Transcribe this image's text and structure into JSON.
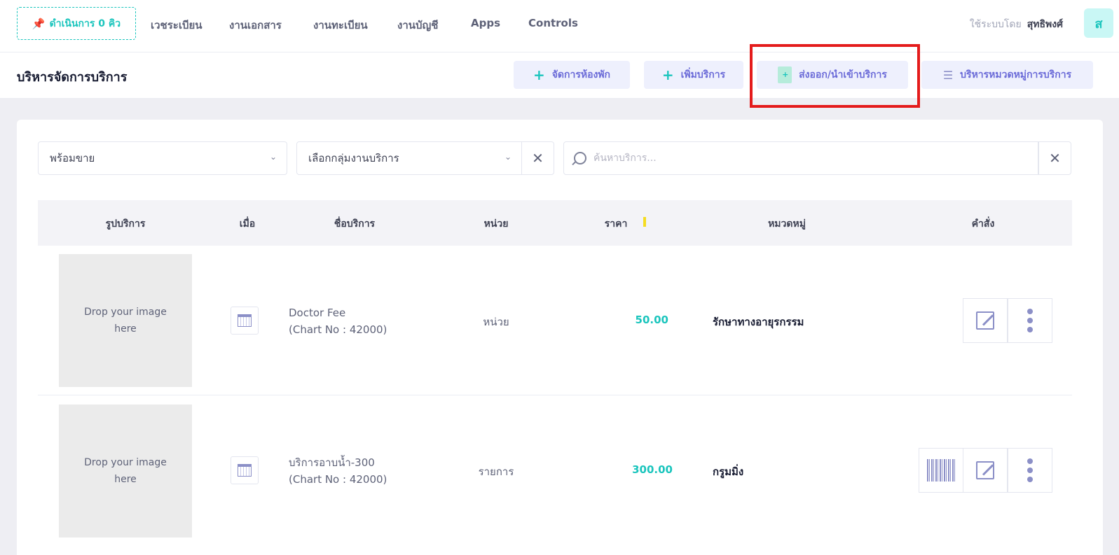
{
  "nav": {
    "queue_label": "ดำเนินการ 0 คิว",
    "items": [
      "เวชระเบียน",
      "งานเอกสาร",
      "งานทะเบียน",
      "งานบัญชี",
      "Apps",
      "Controls"
    ],
    "user_prefix": "ใช้ระบบโดย",
    "user_name": "สุทธิพงศ์",
    "avatar_letter": "ส"
  },
  "subheader": {
    "title": "บริหารจัดการบริการ",
    "buttons": {
      "rooms": "จัดการห้องพัก",
      "add_service": "เพิ่มบริการ",
      "export_import": "ส่งออก/นำเข้าบริการ",
      "categories": "บริหารหมวดหมู่การบริการ"
    }
  },
  "filters": {
    "status_value": "พร้อมขาย",
    "group_value": "เลือกกลุ่มงานบริการ",
    "search_placeholder": "ค้นหาบริการ..."
  },
  "table": {
    "headers": {
      "image": "รูปบริการ",
      "when": "เมื่อ",
      "name": "ชื่อบริการ",
      "unit": "หน่วย",
      "price": "ราคา",
      "category": "หมวดหมู่",
      "actions": "คำสั่ง"
    },
    "rows": [
      {
        "image_text": "Drop your image here",
        "name": "Doctor Fee",
        "chart": "(Chart No : 42000)",
        "unit": "หน่วย",
        "price": "50.00",
        "category": "รักษาทางอายุรกรรม"
      },
      {
        "image_text": "Drop your image here",
        "name": "บริการอาบน้ำ-300",
        "chart": "(Chart No : 42000)",
        "unit": "รายการ",
        "price": "300.00",
        "category": "กรูมมิ่ง"
      }
    ]
  },
  "colors": {
    "accent_teal": "#1bc5bd",
    "accent_purple": "#6b6bd8",
    "highlight_red": "#e41b1b"
  }
}
